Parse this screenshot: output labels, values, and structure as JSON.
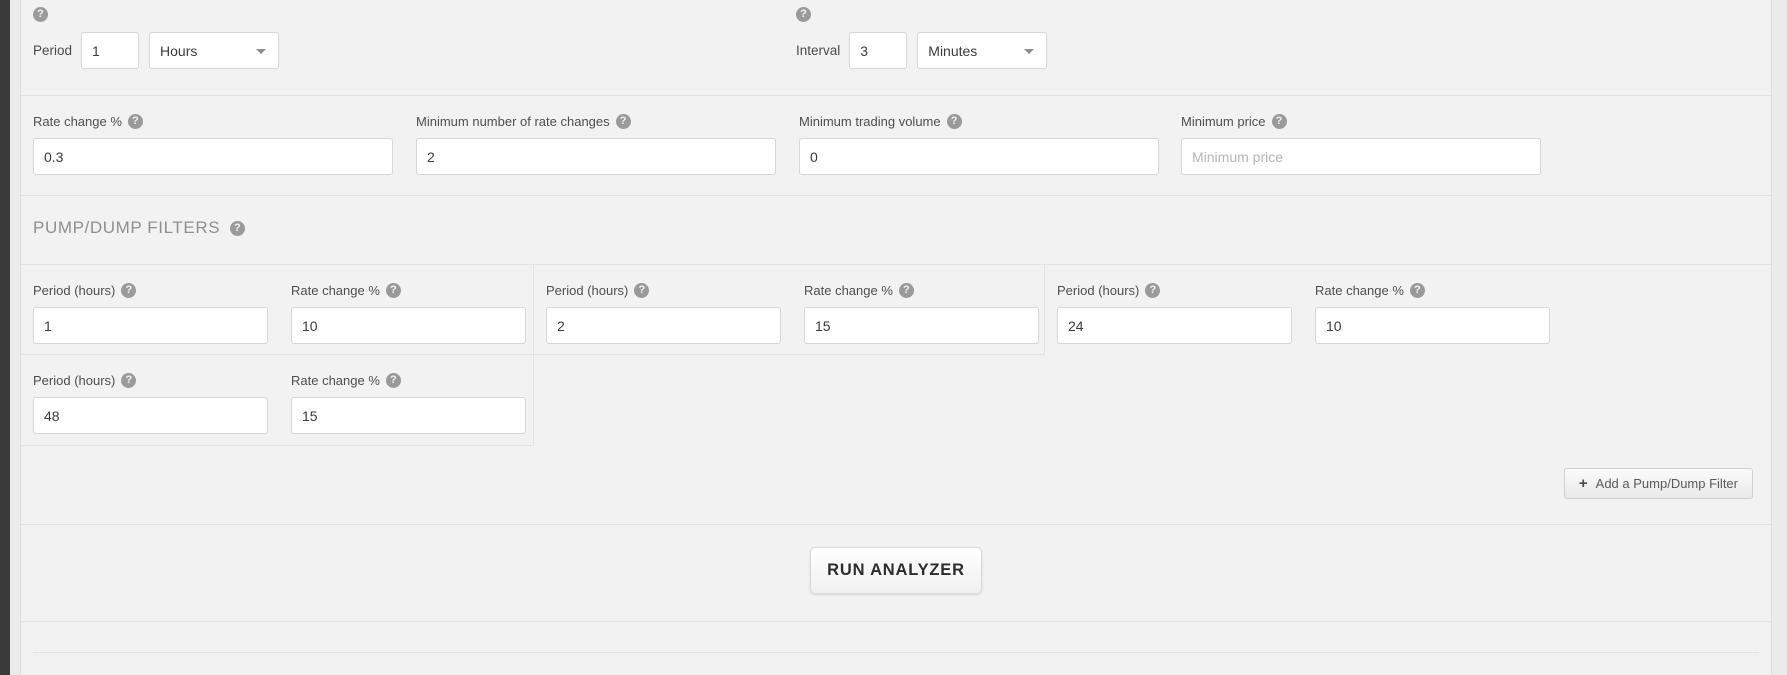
{
  "colors": {
    "page_background": "#ebebeb",
    "card_background": "#f2f2f2",
    "gutter": "#3a3a3a",
    "input_background": "#ffffff",
    "input_border": "#d6d6d6",
    "divider": "#e3e3e3",
    "help_badge": "#9a9a9a",
    "label_text": "#4e4e4e",
    "section_title": "#8f8f8f"
  },
  "help_icon": "question-mark-help-icon",
  "period_row": {
    "period": {
      "label": "Period",
      "value": "1",
      "unit_selected": "Hours",
      "unit_options": [
        "Hours"
      ],
      "help": "?"
    },
    "interval": {
      "label": "Interval",
      "value": "3",
      "unit_selected": "Minutes",
      "unit_options": [
        "Minutes"
      ],
      "help": "?"
    }
  },
  "filter_row": {
    "fields": [
      {
        "label": "Rate change %",
        "value": "0.3",
        "placeholder": "",
        "help": "?"
      },
      {
        "label": "Minimum number of rate changes",
        "value": "2",
        "placeholder": "",
        "help": "?"
      },
      {
        "label": "Minimum trading volume",
        "value": "0",
        "placeholder": "",
        "help": "?"
      },
      {
        "label": "Minimum price",
        "value": "",
        "placeholder": "Minimum price",
        "help": "?"
      }
    ]
  },
  "pump_dump": {
    "title": "PUMP/DUMP FILTERS",
    "help": "?",
    "period_label": "Period (hours)",
    "rate_label": "Rate change %",
    "groups": [
      {
        "period": "1",
        "rate": "10"
      },
      {
        "period": "2",
        "rate": "15"
      },
      {
        "period": "24",
        "rate": "10"
      },
      {
        "period": "48",
        "rate": "15"
      }
    ],
    "add_button": {
      "label": "Add a Pump/Dump Filter",
      "icon": "plus-icon"
    }
  },
  "actions": {
    "run_label": "RUN ANALYZER"
  }
}
